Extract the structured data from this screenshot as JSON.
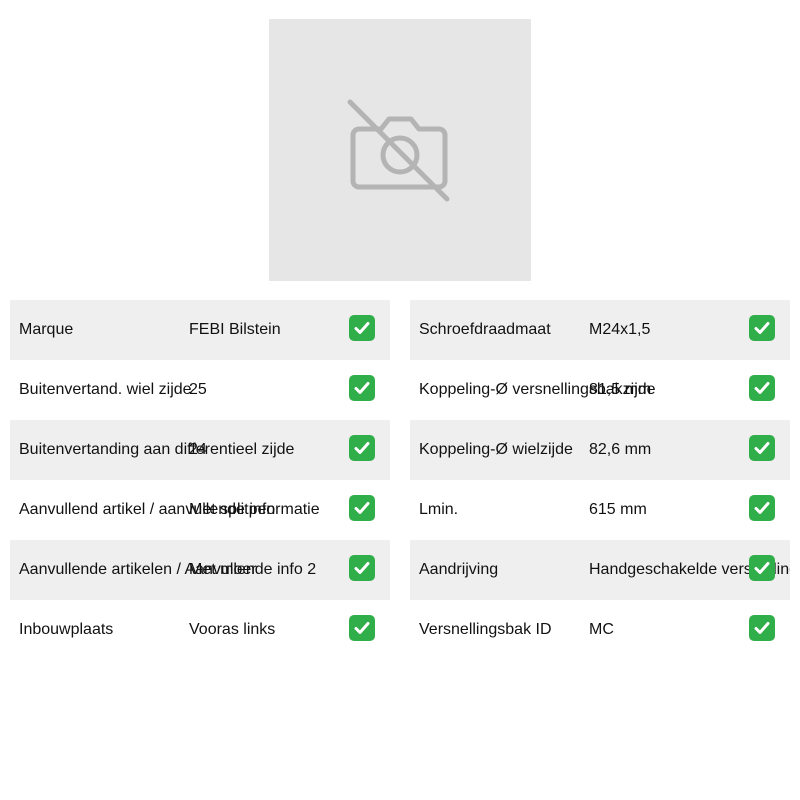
{
  "image": {
    "icon": "camera-off-icon"
  },
  "specs_left": [
    {
      "label": "Marque",
      "value": "FEBI Bilstein",
      "icon": "check-icon"
    },
    {
      "label": "Buitenvertand. wiel zijde",
      "value": "25",
      "icon": "check-icon"
    },
    {
      "label": "Buitenvertanding aan differentieel zijde",
      "value": "24",
      "icon": "check-icon"
    },
    {
      "label": "Aanvullend artikel / aanvullende informatie",
      "value": "Met splitpen",
      "icon": "check-icon"
    },
    {
      "label": "Aanvullende artikelen / Aanvullende info 2",
      "value": "Met moer",
      "icon": "check-icon"
    },
    {
      "label": "Inbouwplaats",
      "value": "Vooras links",
      "icon": "check-icon"
    }
  ],
  "specs_right": [
    {
      "label": "Schroefdraadmaat",
      "value": "M24x1,5",
      "icon": "check-icon"
    },
    {
      "label": "Koppeling-Ø versnellingsbakzijde",
      "value": "81,5 mm",
      "icon": "check-icon"
    },
    {
      "label": "Koppeling-Ø wielzijde",
      "value": "82,6 mm",
      "icon": "check-icon"
    },
    {
      "label": "Lmin.",
      "value": "615 mm",
      "icon": "check-icon"
    },
    {
      "label": "Aandrijving",
      "value": "Handgeschakelde versnellingsbak",
      "icon": "check-icon"
    },
    {
      "label": "Versnellingsbak ID",
      "value": "MC",
      "icon": "check-icon"
    }
  ],
  "colors": {
    "check_bg": "#2fae4a",
    "row_shade": "#efefef",
    "image_bg": "#e6e6e6",
    "icon_gray": "#b4b4b4"
  }
}
